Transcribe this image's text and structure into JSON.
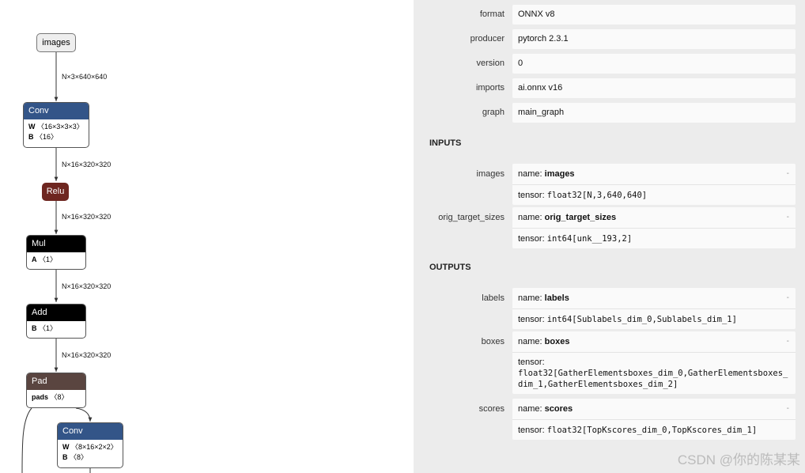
{
  "graph": {
    "input_node": "images",
    "edges": [
      "N×3×640×640",
      "N×16×320×320",
      "N×16×320×320",
      "N×16×320×320",
      "N×16×320×320"
    ],
    "nodes": [
      {
        "op": "Conv",
        "color": "#335588",
        "attrs": [
          {
            "key": "W",
            "val": "〈16×3×3×3〉"
          },
          {
            "key": "B",
            "val": "〈16〉"
          }
        ]
      },
      {
        "op": "Relu",
        "color": "#6e2620",
        "attrs": []
      },
      {
        "op": "Mul",
        "color": "#000000",
        "attrs": [
          {
            "key": "A",
            "val": "〈1〉"
          }
        ]
      },
      {
        "op": "Add",
        "color": "#000000",
        "attrs": [
          {
            "key": "B",
            "val": "〈1〉"
          }
        ]
      },
      {
        "op": "Pad",
        "color": "#5a4540",
        "attrs": [
          {
            "key": "pads",
            "val": "〈8〉"
          }
        ]
      },
      {
        "op": "Conv",
        "color": "#335588",
        "attrs": [
          {
            "key": "W",
            "val": "〈8×16×2×2〉"
          },
          {
            "key": "B",
            "val": "〈8〉"
          }
        ]
      }
    ]
  },
  "model": {
    "properties": [
      {
        "label": "format",
        "value": "ONNX v8"
      },
      {
        "label": "producer",
        "value": "pytorch 2.3.1"
      },
      {
        "label": "version",
        "value": "0"
      },
      {
        "label": "imports",
        "value": "ai.onnx v16"
      },
      {
        "label": "graph",
        "value": "main_graph"
      }
    ],
    "inputs_title": "INPUTS",
    "outputs_title": "OUTPUTS",
    "name_prefix": "name: ",
    "tensor_prefix": "tensor: ",
    "dash": "-",
    "inputs": [
      {
        "label": "images",
        "name": "images",
        "tensor": "float32[N,3,640,640]"
      },
      {
        "label": "orig_target_sizes",
        "name": "orig_target_sizes",
        "tensor": "int64[unk__193,2]"
      }
    ],
    "outputs": [
      {
        "label": "labels",
        "name": "labels",
        "tensor": "int64[Sublabels_dim_0,Sublabels_dim_1]"
      },
      {
        "label": "boxes",
        "name": "boxes",
        "tensor": "float32[GatherElementsboxes_dim_0,GatherElementsboxes_dim_1,GatherElementsboxes_dim_2]"
      },
      {
        "label": "scores",
        "name": "scores",
        "tensor": "float32[TopKscores_dim_0,TopKscores_dim_1]"
      }
    ]
  },
  "watermark": "CSDN @你的陈某某"
}
